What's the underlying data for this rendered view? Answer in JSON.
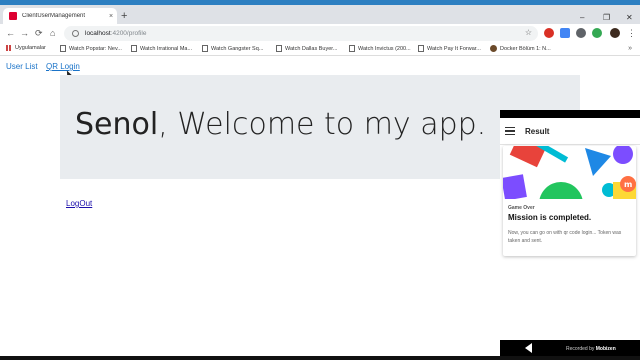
{
  "browser": {
    "tab_title": "ClientUserManagement",
    "tab_close": "×",
    "new_tab": "+",
    "url_host": "localhost",
    "url_path": ":4200/profile",
    "nav": {
      "back": "←",
      "forward": "→",
      "reload": "⟳",
      "home": "⌂"
    },
    "window_controls": {
      "minimize": "–",
      "restore": "❐",
      "close": "✕"
    },
    "star": "☆"
  },
  "bookmarks": {
    "items": [
      {
        "label": "Uygulamalar",
        "icon": "apps-grid-icon"
      },
      {
        "label": "Watch Popstar: Nev...",
        "icon": "page-icon"
      },
      {
        "label": "Watch Irrational Ma...",
        "icon": "page-icon"
      },
      {
        "label": "Watch Gangster Sq...",
        "icon": "page-icon"
      },
      {
        "label": "Watch Dallas Buyer...",
        "icon": "page-icon"
      },
      {
        "label": "Watch Invictus (200...",
        "icon": "page-icon"
      },
      {
        "label": "Watch Pay It Forwar...",
        "icon": "page-icon"
      },
      {
        "label": "Docker Bölüm 1: N...",
        "icon": "avatar-icon"
      }
    ],
    "more": "»"
  },
  "app": {
    "nav": {
      "user_list": "User List",
      "qr_login": "QR Login"
    },
    "welcome_name": "Senol",
    "welcome_text": ", Welcome to my app.",
    "logout": "LogOut"
  },
  "phone": {
    "title": "Result",
    "card": {
      "eyebrow": "Game Over",
      "headline": "Mission is completed.",
      "body": "Now, you can go on with qr code login... Token was taken and sent."
    }
  },
  "recorder": {
    "prefix": "Recorded by",
    "brand": "Mobizen"
  },
  "colors": {
    "accent": "#1a73c8",
    "jumbotron": "#e9ecef"
  }
}
